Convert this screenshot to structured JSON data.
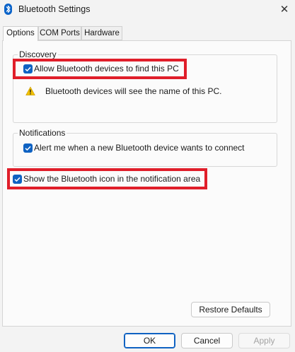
{
  "window": {
    "title": "Bluetooth Settings",
    "close_glyph": "✕"
  },
  "tabs": [
    {
      "label": "Options",
      "active": true
    },
    {
      "label": "COM Ports",
      "active": false
    },
    {
      "label": "Hardware",
      "active": false
    }
  ],
  "discovery": {
    "group_label": "Discovery",
    "allow_find": {
      "label": "Allow Bluetooth devices to find this PC",
      "checked": true
    },
    "warning_icon": "warning-triangle-icon",
    "warning_text": "Bluetooth devices will see the name of this PC."
  },
  "notifications": {
    "group_label": "Notifications",
    "alert_new_device": {
      "label": "Alert me when a new Bluetooth device wants to connect",
      "checked": true
    }
  },
  "show_icon": {
    "label": "Show the Bluetooth icon in the notification area",
    "checked": true
  },
  "buttons": {
    "restore_defaults": "Restore Defaults",
    "ok": "OK",
    "cancel": "Cancel",
    "apply": "Apply"
  },
  "colors": {
    "accent": "#0f62c2",
    "highlight": "#e01e2a",
    "warning": "#f2c100"
  }
}
